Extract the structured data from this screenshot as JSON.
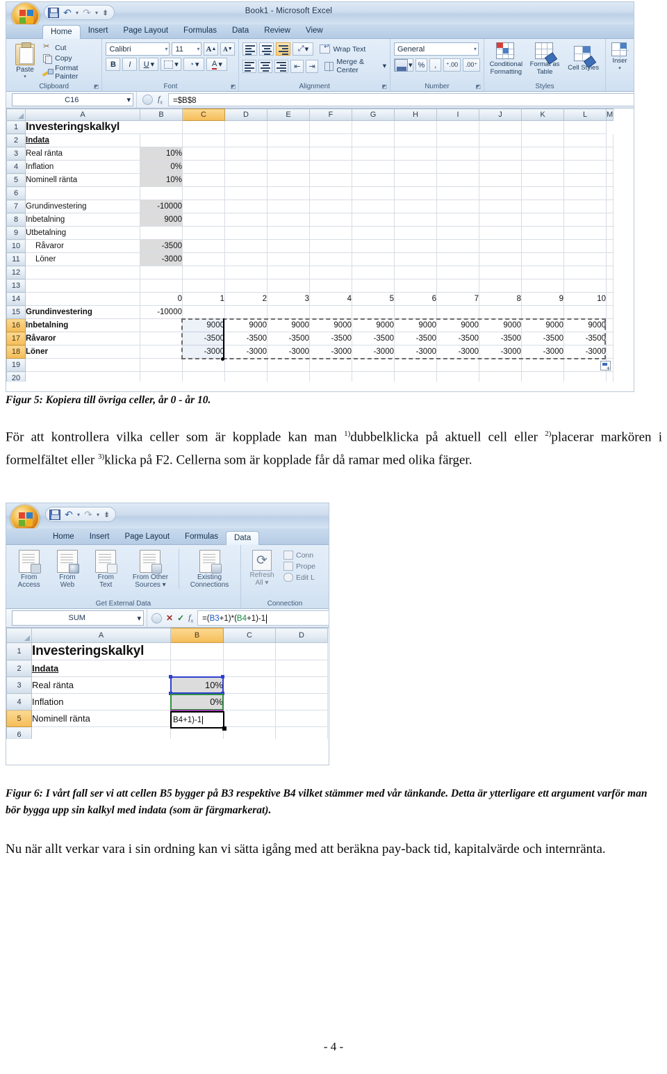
{
  "figure5": {
    "window_title": "Book1 - Microsoft Excel",
    "quick_access": {
      "save": "save-icon",
      "undo": "undo-icon",
      "redo": "redo-icon",
      "more": "customize-icon"
    },
    "tabs": [
      "Home",
      "Insert",
      "Page Layout",
      "Formulas",
      "Data",
      "Review",
      "View"
    ],
    "active_tab": "Home",
    "ribbon": {
      "clipboard": {
        "label": "Clipboard",
        "paste": "Paste",
        "items": [
          "Cut",
          "Copy",
          "Format Painter"
        ]
      },
      "font": {
        "label": "Font",
        "font_name": "Calibri",
        "font_size": "11",
        "grow": "A",
        "shrink": "A",
        "bold": "B",
        "italic": "I",
        "underline": "U",
        "borders": "borders-icon",
        "fill": "A",
        "font_color": "A"
      },
      "alignment": {
        "label": "Alignment",
        "wrap_text": "Wrap Text",
        "merge_center": "Merge & Center"
      },
      "number": {
        "label": "Number",
        "format": "General",
        "percent": "%",
        "comma": ",",
        "inc_dec": ".00",
        "dec_dec": ".00"
      },
      "styles": {
        "label": "Styles",
        "conditional": "Conditional Formatting",
        "format_table": "Format as Table",
        "cell_styles": "Cell Styles"
      },
      "cells": {
        "insert": "Inser"
      }
    },
    "formula_bar": {
      "name_box": "C16",
      "formula": "=$B$8"
    },
    "columns": [
      "A",
      "B",
      "C",
      "D",
      "E",
      "F",
      "G",
      "H",
      "I",
      "J",
      "K",
      "L",
      "M"
    ],
    "selected_column": "C",
    "selected_rows": [
      16,
      17,
      18
    ],
    "rows": [
      {
        "n": 1,
        "A": "Investeringskalkyl",
        "B": "",
        "style": "title"
      },
      {
        "n": 2,
        "A": "Indata",
        "B": "",
        "style": "underbold"
      },
      {
        "n": 3,
        "A": "Real ränta",
        "B": "10%",
        "shaded": true
      },
      {
        "n": 4,
        "A": "Inflation",
        "B": "0%",
        "shaded": true
      },
      {
        "n": 5,
        "A": "Nominell ränta",
        "B": "10%",
        "shaded": true
      },
      {
        "n": 6,
        "A": "",
        "B": ""
      },
      {
        "n": 7,
        "A": "Grundinvestering",
        "B": "-10000",
        "shaded": true
      },
      {
        "n": 8,
        "A": "Inbetalning",
        "B": "9000",
        "shaded": true
      },
      {
        "n": 9,
        "A": "Utbetalning",
        "B": ""
      },
      {
        "n": 10,
        "A": "Råvaror",
        "B": "-3500",
        "shaded": true,
        "indent": true
      },
      {
        "n": 11,
        "A": "Löner",
        "B": "-3000",
        "shaded": true,
        "indent": true
      },
      {
        "n": 12,
        "A": "",
        "B": ""
      },
      {
        "n": 13,
        "A": "",
        "B": ""
      }
    ],
    "year_header": {
      "row": 14,
      "label": "",
      "years": [
        "0",
        "1",
        "2",
        "3",
        "4",
        "5",
        "6",
        "7",
        "8",
        "9",
        "10"
      ]
    },
    "table_rows": [
      {
        "n": 15,
        "label": "Grundinvestering",
        "bold": true,
        "values": [
          "-10000",
          "",
          "",
          "",
          "",
          "",
          "",
          "",
          "",
          "",
          ""
        ]
      },
      {
        "n": 16,
        "label": "Inbetalning",
        "bold": true,
        "values": [
          "",
          "9000",
          "9000",
          "9000",
          "9000",
          "9000",
          "9000",
          "9000",
          "9000",
          "9000",
          "9000"
        ]
      },
      {
        "n": 17,
        "label": "Råvaror",
        "bold": true,
        "values": [
          "",
          "-3500",
          "-3500",
          "-3500",
          "-3500",
          "-3500",
          "-3500",
          "-3500",
          "-3500",
          "-3500",
          "-3500"
        ]
      },
      {
        "n": 18,
        "label": "Löner",
        "bold": true,
        "values": [
          "",
          "-3000",
          "-3000",
          "-3000",
          "-3000",
          "-3000",
          "-3000",
          "-3000",
          "-3000",
          "-3000",
          "-3000"
        ]
      }
    ],
    "trailing_rows": [
      19,
      20
    ],
    "autofill_options": "auto-fill-options-icon"
  },
  "figure6": {
    "tabs": [
      "Home",
      "Insert",
      "Page Layout",
      "Formulas",
      "Data"
    ],
    "active_tab": "Data",
    "ribbon": {
      "get_external_data": {
        "label": "Get External Data",
        "buttons": [
          {
            "l1": "From",
            "l2": "Access",
            "icon": "from-access-icon"
          },
          {
            "l1": "From",
            "l2": "Web",
            "icon": "from-web-icon"
          },
          {
            "l1": "From",
            "l2": "Text",
            "icon": "from-text-icon"
          },
          {
            "l1": "From Other",
            "l2": "Sources",
            "icon": "from-other-sources-icon"
          },
          {
            "l1": "Existing",
            "l2": "Connections",
            "icon": "existing-connections-icon"
          }
        ]
      },
      "connections": {
        "label": "Connection",
        "refresh_l1": "Refresh",
        "refresh_l2": "All",
        "items": [
          "Conn",
          "Prope",
          "Edit L"
        ]
      }
    },
    "formula_bar": {
      "name_box": "SUM",
      "cancel": "cancel-icon",
      "enter": "enter-icon",
      "fx": "fx",
      "formula_parts": [
        {
          "t": "=(",
          "c": "plain"
        },
        {
          "t": "B3",
          "c": "blue"
        },
        {
          "t": "+1)*(",
          "c": "plain"
        },
        {
          "t": "B4",
          "c": "green"
        },
        {
          "t": "+1)-1",
          "c": "plain"
        }
      ],
      "formula_full": "=(B3+1)*(B4+1)-1"
    },
    "columns": [
      "A",
      "B",
      "C",
      "D"
    ],
    "selected_column": "B",
    "selected_rows": [
      5
    ],
    "rows": [
      {
        "n": 1,
        "A": "Investeringskalkyl",
        "B": "",
        "style": "title"
      },
      {
        "n": 2,
        "A": "Indata",
        "B": "",
        "style": "underbold"
      },
      {
        "n": 3,
        "A": "Real ränta",
        "B": "10%",
        "shaded": true,
        "trace": "blue"
      },
      {
        "n": 4,
        "A": "Inflation",
        "B": "0%",
        "shaded": true,
        "trace": "green"
      },
      {
        "n": 5,
        "A": "Nominell ränta",
        "B": "",
        "editing": true
      },
      {
        "n": 6,
        "A": "",
        "B": ""
      }
    ],
    "editing_cell_text": "B4+1)-1"
  },
  "document": {
    "caption5": "Figur 5: Kopiera till övriga celler, år 0 - år 10.",
    "para1": {
      "s1": "För att kontrollera vilka celler som är kopplade kan man ",
      "sup1": "1)",
      "s2": "dubbelklicka på aktuell cell eller ",
      "sup2": "2)",
      "s3": "placerar markören i formelfältet eller ",
      "sup3": "3)",
      "s4": "klicka på F2. Cellerna som är kopplade får då ramar med olika färger."
    },
    "caption6": "Figur 6: I vårt fall ser vi att cellen B5 bygger på B3 respektive B4 vilket stämmer med vår tänkande. Detta är ytterligare ett argument varför man bör bygga upp sin kalkyl med indata (som är färgmarkerat).",
    "para2": "Nu när allt verkar vara i sin ordning kan vi sätta igång med att beräkna pay-back tid, kapitalvärde och internränta.",
    "page_number": "- 4 -"
  }
}
